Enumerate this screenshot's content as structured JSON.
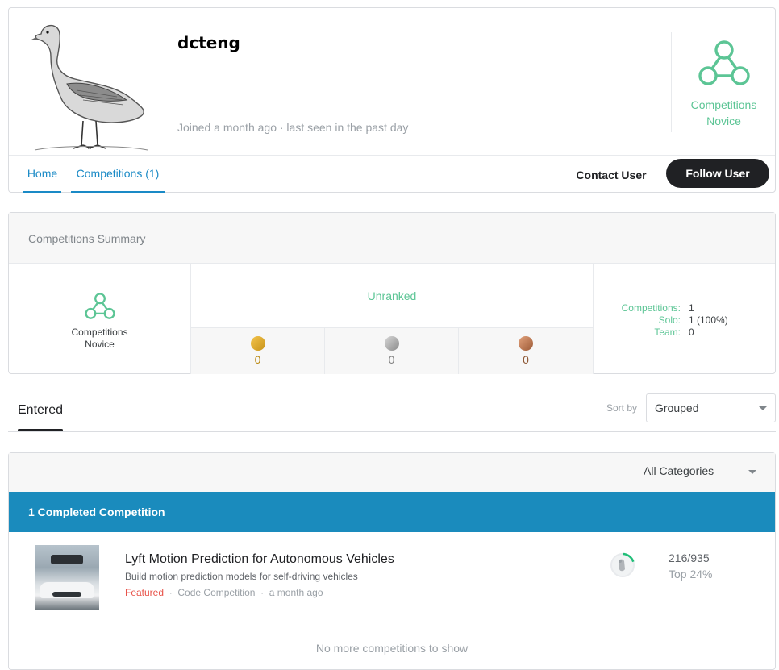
{
  "profile": {
    "username": "dcteng",
    "joined": "Joined a month ago · last seen in the past day",
    "tier_category": "Competitions",
    "tier_level": "Novice",
    "tier_color": "#5cc595"
  },
  "tabs": [
    {
      "label": "Home"
    },
    {
      "label": "Competitions (1)"
    }
  ],
  "actions": {
    "contact_label": "Contact User",
    "follow_label": "Follow User"
  },
  "summary": {
    "title": "Competitions Summary",
    "tier_category": "Competitions",
    "tier_level": "Novice",
    "rank": "Unranked",
    "medals": {
      "gold": "0",
      "silver": "0",
      "bronze": "0"
    },
    "stats": [
      {
        "label": "Competitions:",
        "value": "1"
      },
      {
        "label": "Solo:",
        "value": "1 (100%)"
      },
      {
        "label": "Team:",
        "value": "0"
      }
    ]
  },
  "entered": {
    "tab_label": "Entered",
    "sort_label": "Sort by",
    "sort_value": "Grouped"
  },
  "list": {
    "category": "All Categories",
    "completed_header": "1 Completed Competition",
    "competition": {
      "title": "Lyft Motion Prediction for Autonomous Vehicles",
      "description": "Build motion prediction models for self-driving vehicles",
      "type": "Featured",
      "kind": "Code Competition",
      "when": "a month ago",
      "rank": "216/935",
      "top": "Top 24%"
    },
    "footer": "No more competitions to show"
  },
  "colors": {
    "accent_blue": "#1a8ac6",
    "header_bar": "#1a8bbd",
    "tier_green": "#5cc595",
    "featured_red": "#e8534a",
    "button_dark": "#202124"
  },
  "icons": [
    "goose-avatar",
    "competitions-tier-icon",
    "gold-medal-icon",
    "silver-medal-icon",
    "bronze-medal-icon",
    "chevron-down-icon",
    "rank-progress-icon"
  ]
}
